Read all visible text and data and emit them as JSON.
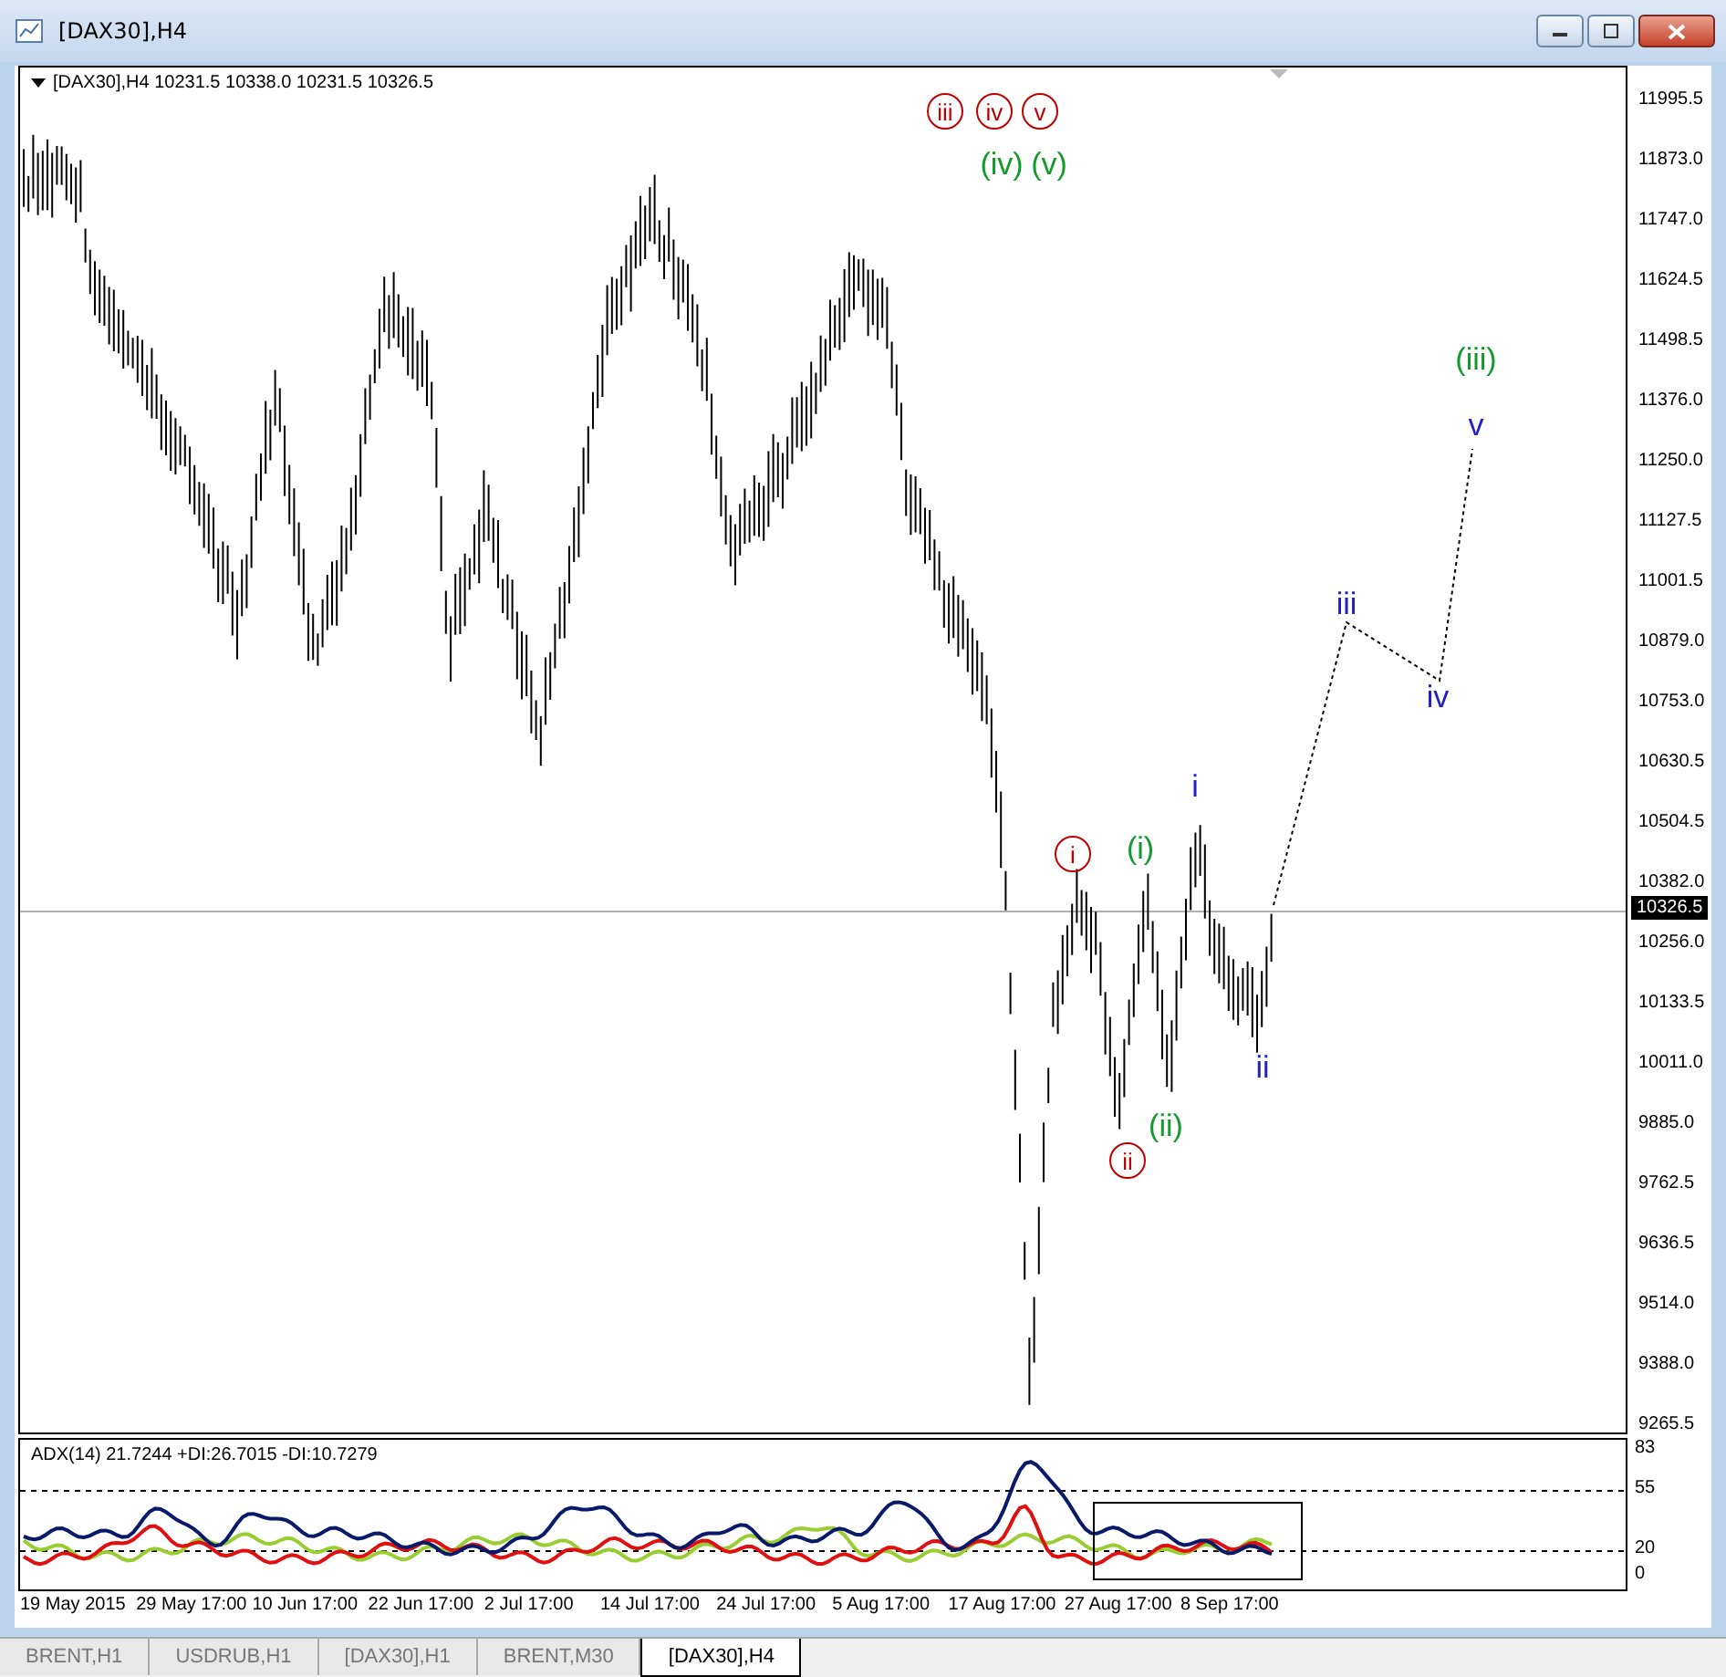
{
  "window": {
    "title": "[DAX30],H4"
  },
  "chart": {
    "header": "[DAX30],H4  10231.5 10338.0 10231.5 10326.5",
    "price_ticks": [
      "11995.5",
      "11873.0",
      "11747.0",
      "11624.5",
      "11498.5",
      "11376.0",
      "11250.0",
      "11127.5",
      "11001.5",
      "10879.0",
      "10753.0",
      "10630.5",
      "10504.5",
      "10382.0",
      "10256.0",
      "10133.5",
      "10011.0",
      "9885.0",
      "9762.5",
      "9636.5",
      "9514.0",
      "9388.0",
      "9265.5"
    ],
    "current_price": "10326.5",
    "wave_labels": [
      {
        "text": "iii",
        "kind": "circled",
        "color": "#c00000"
      },
      {
        "text": "iv",
        "kind": "circled",
        "color": "#c00000"
      },
      {
        "text": "v",
        "kind": "circled",
        "color": "#c00000"
      },
      {
        "text": "(iv)",
        "kind": "plain",
        "color": "#129a2a"
      },
      {
        "text": "(v)",
        "kind": "plain",
        "color": "#129a2a"
      },
      {
        "text": "(iii)",
        "kind": "plain",
        "color": "#129a2a"
      },
      {
        "text": "v",
        "kind": "plain",
        "color": "#2020c8"
      },
      {
        "text": "iii",
        "kind": "plain",
        "color": "#2020c8"
      },
      {
        "text": "iv",
        "kind": "plain",
        "color": "#2020c8"
      },
      {
        "text": "i",
        "kind": "circled",
        "color": "#c00000"
      },
      {
        "text": "(i)",
        "kind": "plain",
        "color": "#129a2a"
      },
      {
        "text": "i",
        "kind": "plain",
        "color": "#2020c8"
      },
      {
        "text": "ii",
        "kind": "circled",
        "color": "#c00000"
      },
      {
        "text": "(ii)",
        "kind": "plain",
        "color": "#129a2a"
      },
      {
        "text": "ii",
        "kind": "plain",
        "color": "#2020c8"
      }
    ],
    "indicator": {
      "label": "ADX(14) 21.7244 +DI:26.7015 -DI:10.7279",
      "ticks": [
        "83",
        "55",
        "20",
        "0"
      ]
    },
    "time_ticks": [
      "19 May 2015",
      "29 May 17:00",
      "10 Jun 17:00",
      "22 Jun 17:00",
      "2 Jul 17:00",
      "14 Jul 17:00",
      "24 Jul 17:00",
      "5 Aug 17:00",
      "17 Aug 17:00",
      "27 Aug 17:00",
      "8 Sep 17:00"
    ]
  },
  "tabs": [
    {
      "label": "BRENT,H1",
      "selected": false
    },
    {
      "label": "USDRUB,H1",
      "selected": false
    },
    {
      "label": "[DAX30],H1",
      "selected": false
    },
    {
      "label": "BRENT,M30",
      "selected": false
    },
    {
      "label": "[DAX30],H4",
      "selected": true
    }
  ]
}
